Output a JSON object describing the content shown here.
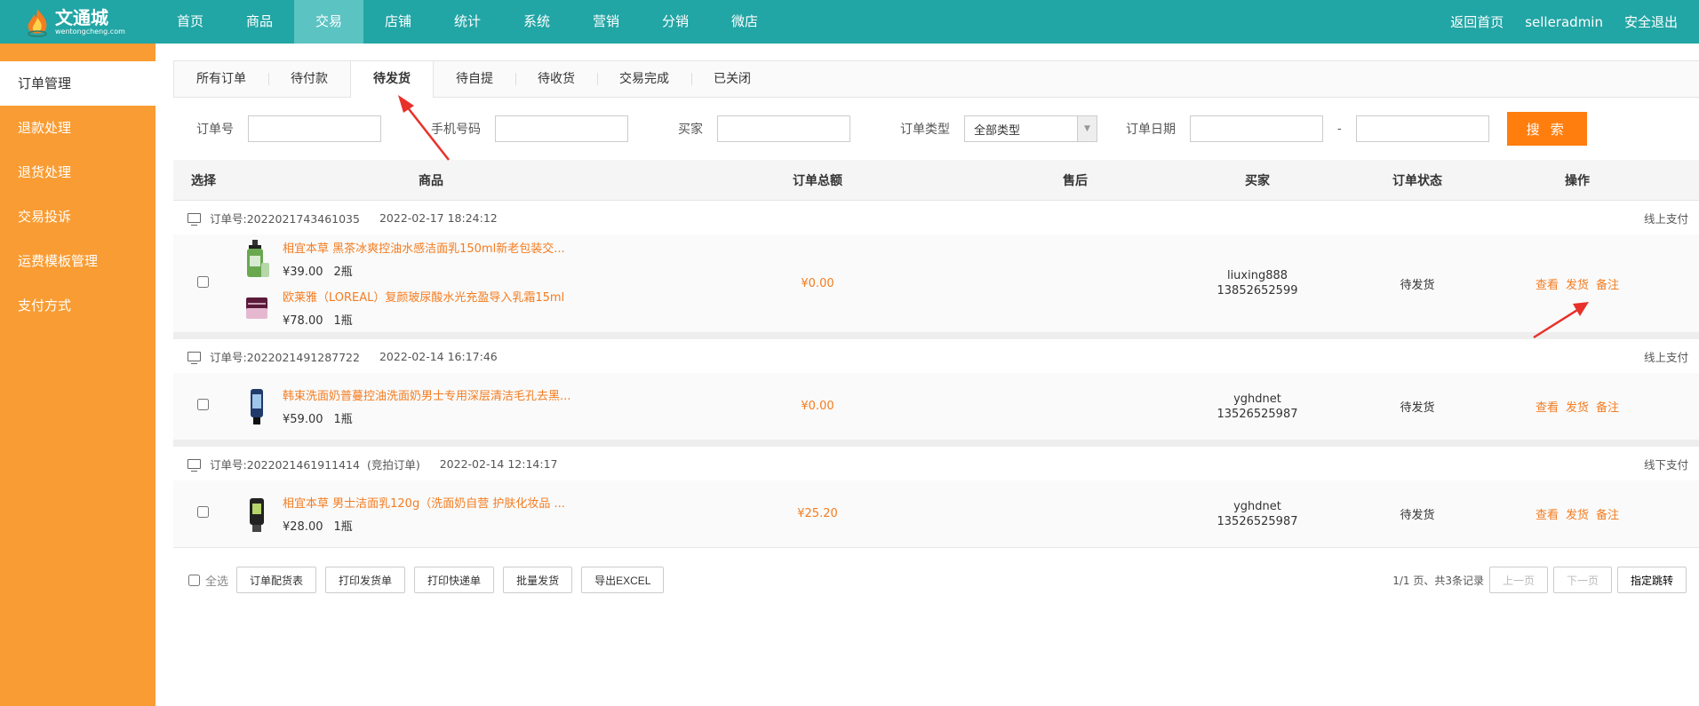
{
  "logo": {
    "title": "文通城",
    "subtitle": "wentongcheng.com"
  },
  "nav": [
    "首页",
    "商品",
    "交易",
    "店铺",
    "统计",
    "系统",
    "营销",
    "分销",
    "微店"
  ],
  "nav_active": "交易",
  "top_right": {
    "home": "返回首页",
    "user": "selleradmin",
    "logout": "安全退出"
  },
  "sidebar": [
    "订单管理",
    "退款处理",
    "退货处理",
    "交易投诉",
    "运费模板管理",
    "支付方式"
  ],
  "tabs": [
    "所有订单",
    "待付款",
    "待发货",
    "待自提",
    "待收货",
    "交易完成",
    "已关闭"
  ],
  "search": {
    "order_no": "订单号",
    "phone": "手机号码",
    "buyer": "买家",
    "type_label": "订单类型",
    "type_value": "全部类型",
    "date_label": "订单日期",
    "dash": "-",
    "button": "搜 索"
  },
  "table_header": {
    "select": "选择",
    "goods": "商品",
    "total": "订单总额",
    "after": "售后",
    "buyer": "买家",
    "state": "订单状态",
    "ops": "操作"
  },
  "orders": [
    {
      "no": "订单号:2022021743461035",
      "time": "2022-02-17 18:24:12",
      "tag": "",
      "pay": "线上支付",
      "total": "¥0.00",
      "buyer_name": "liuxing888",
      "buyer_phone": "13852652599",
      "state": "待发货",
      "items": [
        {
          "title": "相宜本草 黑茶冰爽控油水感洁面乳150ml新老包装交...",
          "price": "¥39.00",
          "qty": "2瓶"
        },
        {
          "title": "欧莱雅（LOREAL）复颜玻尿酸水光充盈导入乳霜15ml",
          "price": "¥78.00",
          "qty": "1瓶"
        }
      ]
    },
    {
      "no": "订单号:2022021491287722",
      "time": "2022-02-14 16:17:46",
      "tag": "",
      "pay": "线上支付",
      "total": "¥0.00",
      "buyer_name": "yghdnet",
      "buyer_phone": "13526525987",
      "state": "待发货",
      "items": [
        {
          "title": "韩束洗面奶普蔓控油洗面奶男士专用深层清洁毛孔去黑...",
          "price": "¥59.00",
          "qty": "1瓶"
        }
      ]
    },
    {
      "no": "订单号:2022021461911414",
      "time": "2022-02-14 12:14:17",
      "tag": "(竞拍订单)",
      "pay": "线下支付",
      "total": "¥25.20",
      "buyer_name": "yghdnet",
      "buyer_phone": "13526525987",
      "state": "待发货",
      "items": [
        {
          "title": "相宜本草 男士洁面乳120g（洗面奶自营 护肤化妆品 ...",
          "price": "¥28.00",
          "qty": "1瓶"
        }
      ]
    }
  ],
  "ops": {
    "view": "查看",
    "ship": "发货",
    "note": "备注"
  },
  "footer": {
    "select_all": "全选",
    "buttons": [
      "订单配货表",
      "打印发货单",
      "打印快递单",
      "批量发货",
      "导出EXCEL"
    ]
  },
  "pager": {
    "info": "1/1 页、共3条记录",
    "prev": "上一页",
    "next": "下一页",
    "jump": "指定跳转"
  },
  "colors": {
    "topbar": "#22a5a5",
    "sidebar": "#f99c33",
    "accent": "#f47c20",
    "search_button": "#ff7e0e",
    "annotation_arrow": "#e8312a"
  }
}
